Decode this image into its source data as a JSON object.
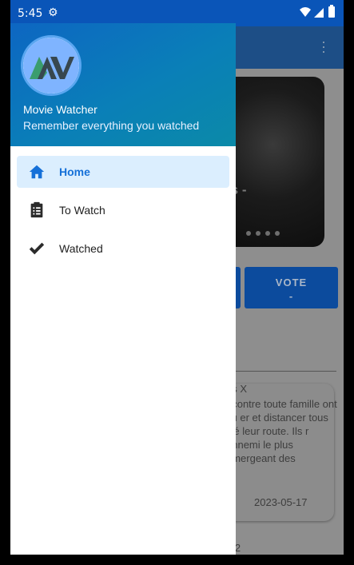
{
  "status_bar": {
    "time": "5:45"
  },
  "drawer": {
    "app_name": "Movie Watcher",
    "tagline": "Remember everything you watched",
    "items": [
      {
        "label": "Home",
        "icon": "home-icon",
        "active": true
      },
      {
        "label": "To Watch",
        "icon": "clipboard-list-icon",
        "active": false
      },
      {
        "label": "Watched",
        "icon": "checkmark-icon",
        "active": false
      }
    ]
  },
  "background": {
    "poster_title_fragment": "ts -",
    "vote_label": "VOTE",
    "vote_value": "-",
    "card_title_fragment": "us X",
    "card_text_fragment": "t contre toute famille ont su er et distancer tous isé leur route. Ils r ennemi le plus émergeant des",
    "card_date": "2023-05-17",
    "bottom_fragment": "e 2"
  },
  "colors": {
    "status_bar": "#0a55b8",
    "accent": "#1570d8",
    "active_item_bg": "#dbeefe"
  }
}
